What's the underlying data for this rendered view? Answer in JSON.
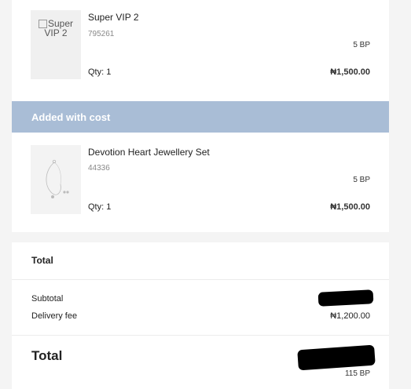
{
  "items_top": [
    {
      "name": "Super VIP 2",
      "code": "795261",
      "bp": "5 BP",
      "qty": "Qty: 1",
      "price": "₦1,500.00",
      "image_alt": "Super VIP 2"
    }
  ],
  "added_section": {
    "title": "Added with cost",
    "items": [
      {
        "name": "Devotion Heart Jewellery Set",
        "code": "44336",
        "bp": "5 BP",
        "qty": "Qty: 1",
        "price": "₦1,500.00"
      }
    ]
  },
  "totals": {
    "heading": "Total",
    "subtotal_label": "Subtotal",
    "delivery_label": "Delivery fee",
    "delivery_value": "₦1,200.00",
    "grand_label": "Total",
    "grand_bp": "115 BP"
  },
  "colors": {
    "section_header_bg": "#a9bdd6",
    "page_bg": "#f4f4f4"
  }
}
